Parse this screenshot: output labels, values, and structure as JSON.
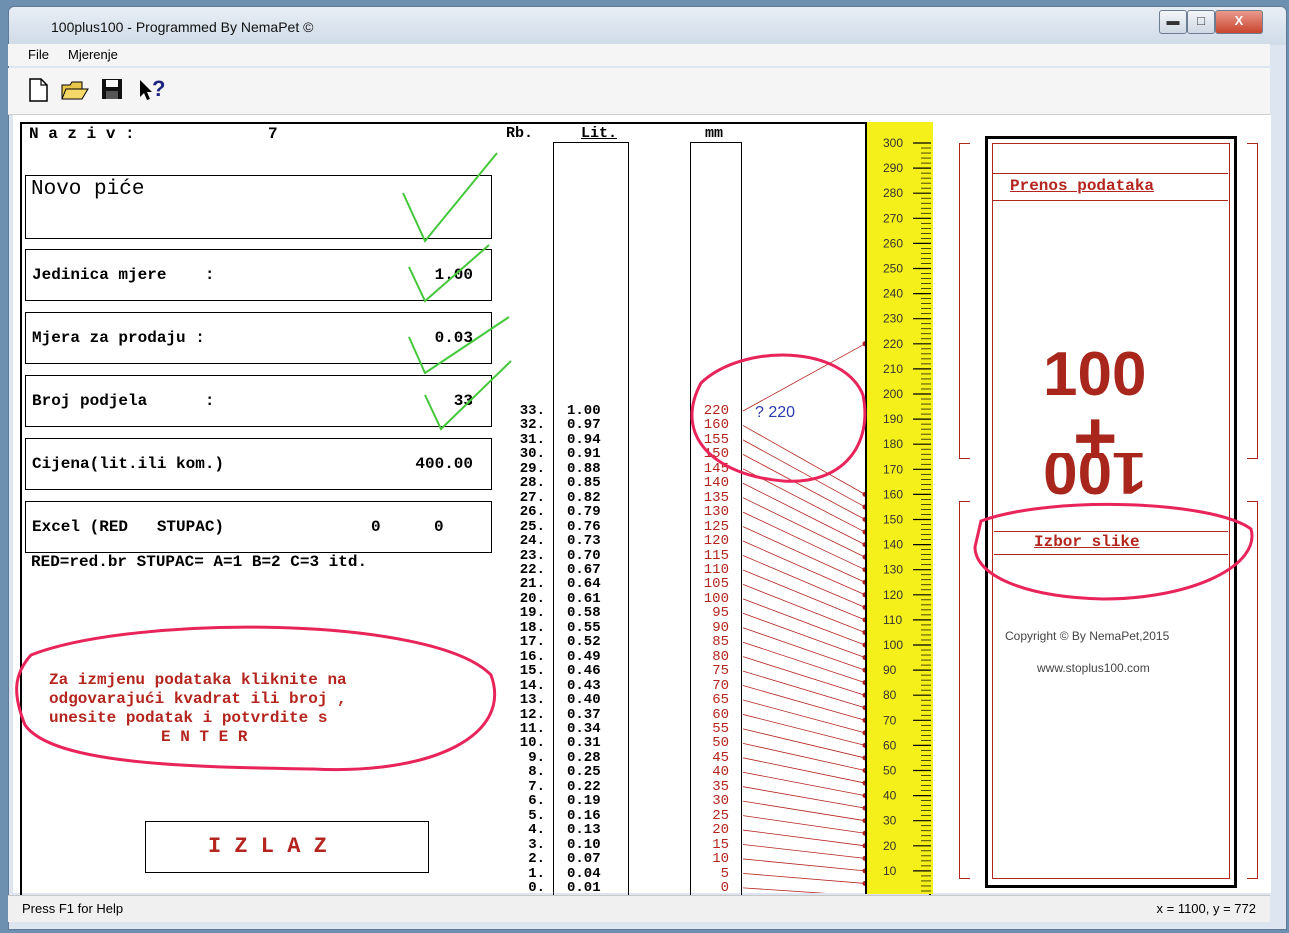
{
  "window": {
    "title": "100plus100 - Programmed By NemaPet ©"
  },
  "menu": [
    "File",
    "Mjerenje"
  ],
  "toolbar": {
    "icons": [
      "new-file-icon",
      "open-folder-icon",
      "save-disk-icon",
      "help-pointer-icon"
    ],
    "help_glyph": "?"
  },
  "left": {
    "naziv_label": "N a z i v :",
    "naziv_num": "7",
    "name_value": "Novo piće",
    "fields": [
      {
        "label": "Jedinica mjere    :",
        "value": "1.00"
      },
      {
        "label": "Mjera za prodaju :",
        "value": "0.03"
      },
      {
        "label": "Broj podjela      :",
        "value": "33"
      },
      {
        "label": "Cijena(lit.ili kom.)",
        "value": "400.00"
      }
    ],
    "excel": {
      "label": "Excel (RED   STUPAC)",
      "red": "0",
      "stupac": "0"
    },
    "note": "RED=red.br STUPAC= A=1 B=2 C=3 itd.",
    "instructions": [
      "Za izmjenu podataka kliknite na",
      "odgovarajući kvadrat ili broj ,",
      "unesite podatak i potvrdite s",
      "E N T E R"
    ],
    "exit_label": "I Z L A Z"
  },
  "table": {
    "headers": {
      "rb": "Rb.",
      "lit": "Lit.",
      "mm": "mm"
    },
    "rb": [
      "33.",
      "32.",
      "31.",
      "30.",
      "29.",
      "28.",
      "27.",
      "26.",
      "25.",
      "24.",
      "23.",
      "22.",
      "21.",
      "20.",
      "19.",
      "18.",
      "17.",
      "16.",
      "15.",
      "14.",
      "13.",
      "12.",
      "11.",
      "10.",
      "9.",
      "8.",
      "7.",
      "6.",
      "5.",
      "4.",
      "3.",
      "2.",
      "1.",
      "0."
    ],
    "lit": [
      "1.00",
      "0.97",
      "0.94",
      "0.91",
      "0.88",
      "0.85",
      "0.82",
      "0.79",
      "0.76",
      "0.73",
      "0.70",
      "0.67",
      "0.64",
      "0.61",
      "0.58",
      "0.55",
      "0.52",
      "0.49",
      "0.46",
      "0.43",
      "0.40",
      "0.37",
      "0.34",
      "0.31",
      "0.28",
      "0.25",
      "0.22",
      "0.19",
      "0.16",
      "0.13",
      "0.10",
      "0.07",
      "0.04",
      "0.01"
    ],
    "mm": [
      "220",
      "160",
      "155",
      "150",
      "145",
      "140",
      "135",
      "130",
      "125",
      "120",
      "115",
      "110",
      "105",
      "100",
      "95",
      "90",
      "85",
      "80",
      "75",
      "70",
      "65",
      "60",
      "55",
      "50",
      "45",
      "40",
      "35",
      "30",
      "25",
      "20",
      "15",
      "10",
      "5",
      "0"
    ],
    "query": "? 220"
  },
  "ruler": {
    "labels": [
      "300",
      "290",
      "280",
      "270",
      "260",
      "250",
      "240",
      "230",
      "220",
      "210",
      "200",
      "190",
      "180",
      "170",
      "160",
      "150",
      "140",
      "130",
      "120",
      "110",
      "100",
      "90",
      "80",
      "70",
      "60",
      "50",
      "40",
      "30",
      "20",
      "10"
    ],
    "color": "#f6f01a"
  },
  "right": {
    "prenos_label": "Prenos podataka",
    "logo_top": "100",
    "logo_plus": "+",
    "logo_bottom": "100",
    "izbor_label": "Izbor slike",
    "copyright": "Copyright © By NemaPet,2015",
    "url": "www.stoplus100.com"
  },
  "status": {
    "help": "Press F1 for Help",
    "coords": "x = 1100, y = 772"
  },
  "colors": {
    "accent_red": "#b5251f",
    "annotation_pink": "#e8245a",
    "check_green": "#44c83a"
  }
}
